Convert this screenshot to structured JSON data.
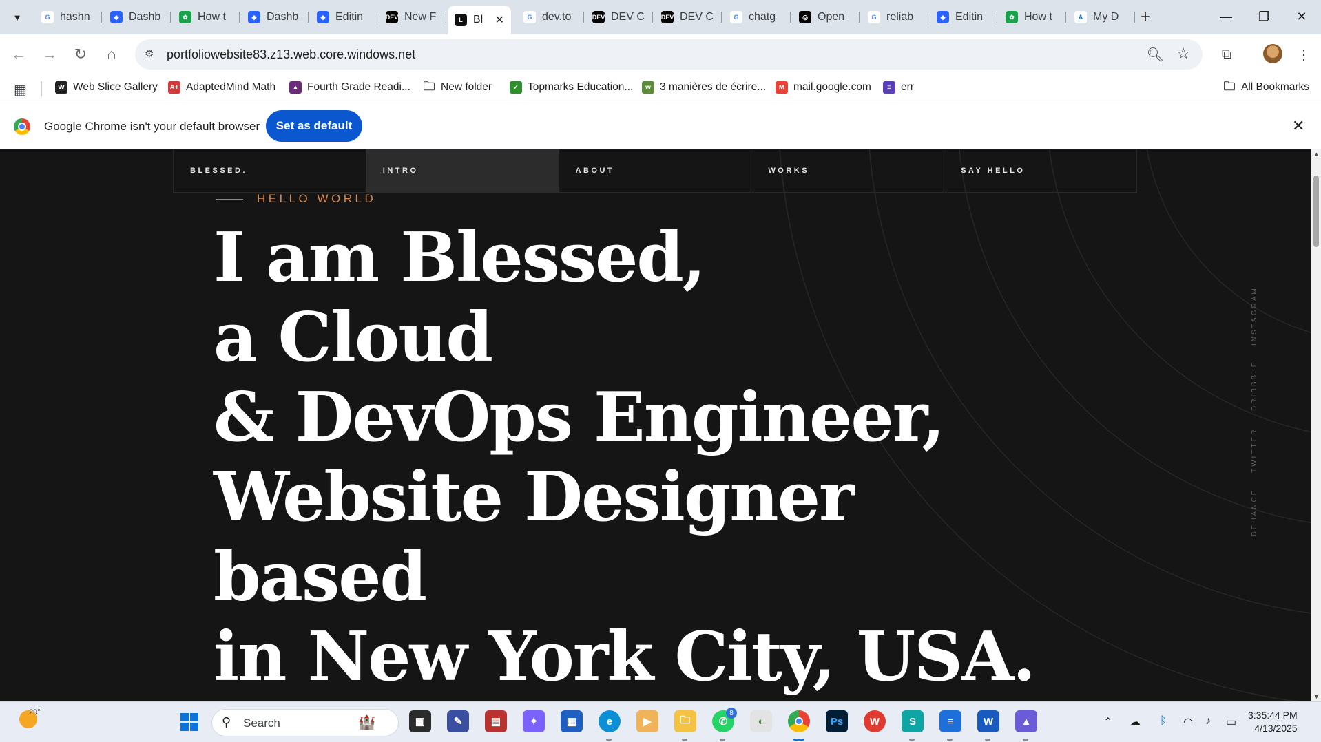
{
  "tabs": [
    {
      "label": "hashn",
      "favicon": "G",
      "color": "#ffffff",
      "fg": "#4285f4"
    },
    {
      "label": "Dashb",
      "favicon": "◆",
      "color": "#2962ff",
      "fg": "#ffffff"
    },
    {
      "label": "How t",
      "favicon": "✿",
      "color": "#16a34a",
      "fg": "#ffffff"
    },
    {
      "label": "Dashb",
      "favicon": "◆",
      "color": "#2962ff",
      "fg": "#ffffff"
    },
    {
      "label": "Editin",
      "favicon": "◆",
      "color": "#2962ff",
      "fg": "#ffffff"
    },
    {
      "label": "New F",
      "favicon": "DEV",
      "color": "#000000",
      "fg": "#ffffff"
    },
    {
      "label": "Bl",
      "favicon": "L",
      "color": "#111111",
      "fg": "#ffffff",
      "active": true
    },
    {
      "label": "dev.to",
      "favicon": "G",
      "color": "#ffffff",
      "fg": "#4285f4"
    },
    {
      "label": "DEV C",
      "favicon": "DEV",
      "color": "#000000",
      "fg": "#ffffff"
    },
    {
      "label": "DEV C",
      "favicon": "DEV",
      "color": "#000000",
      "fg": "#ffffff"
    },
    {
      "label": "chatg",
      "favicon": "G",
      "color": "#ffffff",
      "fg": "#4285f4"
    },
    {
      "label": "Open",
      "favicon": "◎",
      "color": "#000000",
      "fg": "#ffffff"
    },
    {
      "label": "reliab",
      "favicon": "G",
      "color": "#ffffff",
      "fg": "#4285f4"
    },
    {
      "label": "Editin",
      "favicon": "◆",
      "color": "#2962ff",
      "fg": "#ffffff"
    },
    {
      "label": "How t",
      "favicon": "✿",
      "color": "#16a34a",
      "fg": "#ffffff"
    },
    {
      "label": "My D",
      "favicon": "A",
      "color": "#ffffff",
      "fg": "#0078d4"
    }
  ],
  "address": {
    "url": "portfoliowebsite83.z13.web.core.windows.net"
  },
  "bookmarks": [
    {
      "label": "Web Slice Gallery",
      "icon": "W",
      "color": "#222222"
    },
    {
      "label": "AdaptedMind Math",
      "icon": "A+",
      "color": "#d23b3b"
    },
    {
      "label": "Fourth Grade Readi...",
      "icon": "▲",
      "color": "#6b2a7a"
    },
    {
      "label": "New folder",
      "icon": "folder"
    },
    {
      "label": "Topmarks Education...",
      "icon": "✓",
      "color": "#2f8f2f"
    },
    {
      "label": "3 manières de écrire...",
      "icon": "w",
      "color": "#5a8a3a"
    },
    {
      "label": "mail.google.com",
      "icon": "M",
      "color": "#ea4335"
    },
    {
      "label": "err",
      "icon": "≡",
      "color": "#5b3fb8"
    }
  ],
  "bookmarks_all": "All Bookmarks",
  "infobar": {
    "message": "Google Chrome isn't your default browser",
    "button": "Set as default"
  },
  "site": {
    "nav": [
      "BLESSED.",
      "INTRO",
      "ABOUT",
      "WORKS",
      "SAY HELLO"
    ],
    "active_nav": "INTRO",
    "kicker": "HELLO WORLD",
    "headline": [
      "I am Blessed,",
      "a Cloud",
      "& DevOps Engineer,",
      "Website Designer",
      "based",
      "in New York City, USA."
    ],
    "social": [
      "INSTAGRAM",
      "DRIBBBLE",
      "TWITTER",
      "BEHANCE"
    ],
    "accent": "#d9894a"
  },
  "taskbar": {
    "weather": "29°",
    "search": "Search",
    "whatsapp_badge": "8",
    "time": "3:35:44 PM",
    "date": "4/13/2025"
  }
}
